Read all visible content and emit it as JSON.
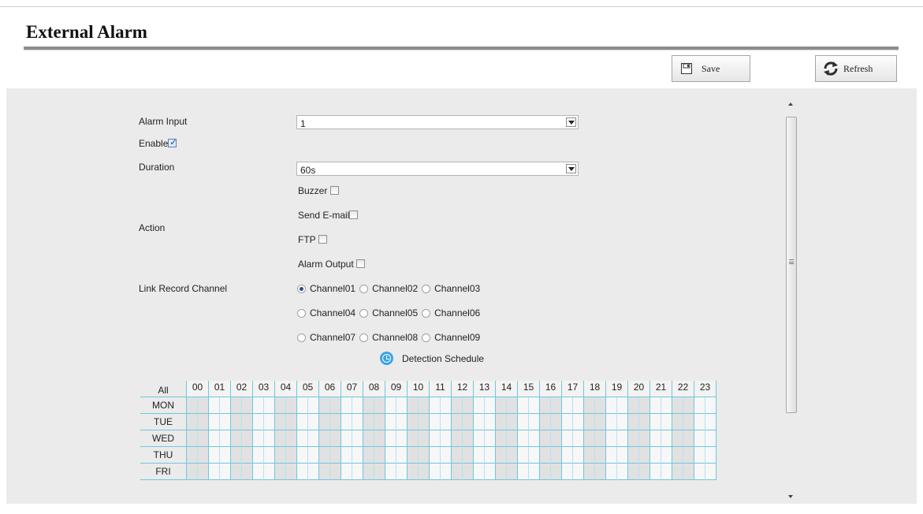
{
  "page": {
    "title": "External Alarm"
  },
  "toolbar": {
    "save_label": "Save",
    "refresh_label": "Refresh"
  },
  "form": {
    "alarm_input_label": "Alarm Input",
    "alarm_input_value": "1",
    "enable_label": "Enable",
    "enable_checked": true,
    "duration_label": "Duration",
    "duration_value": "60s",
    "action_label": "Action",
    "actions": [
      {
        "label": "Buzzer",
        "checked": false
      },
      {
        "label": "Send E-mail",
        "checked": false
      },
      {
        "label": "FTP",
        "checked": false
      },
      {
        "label": "Alarm Output",
        "checked": false
      }
    ],
    "link_record_label": "Link Record Channel",
    "channels": [
      {
        "label": "Channel01",
        "selected": true
      },
      {
        "label": "Channel02",
        "selected": false
      },
      {
        "label": "Channel03",
        "selected": false
      },
      {
        "label": "Channel04",
        "selected": false
      },
      {
        "label": "Channel05",
        "selected": false
      },
      {
        "label": "Channel06",
        "selected": false
      },
      {
        "label": "Channel07",
        "selected": false
      },
      {
        "label": "Channel08",
        "selected": false
      },
      {
        "label": "Channel09",
        "selected": false
      }
    ]
  },
  "schedule": {
    "title": "Detection Schedule",
    "all_label": "All",
    "hours": [
      "00",
      "01",
      "02",
      "03",
      "04",
      "05",
      "06",
      "07",
      "08",
      "09",
      "10",
      "11",
      "12",
      "13",
      "14",
      "15",
      "16",
      "17",
      "18",
      "19",
      "20",
      "21",
      "22",
      "23"
    ],
    "days": [
      "MON",
      "TUE",
      "WED",
      "THU",
      "FRI"
    ]
  },
  "icons": {
    "save": "save-icon",
    "refresh": "refresh-icon",
    "schedule": "clock-icon",
    "dropdown": "chevron-down-icon"
  }
}
